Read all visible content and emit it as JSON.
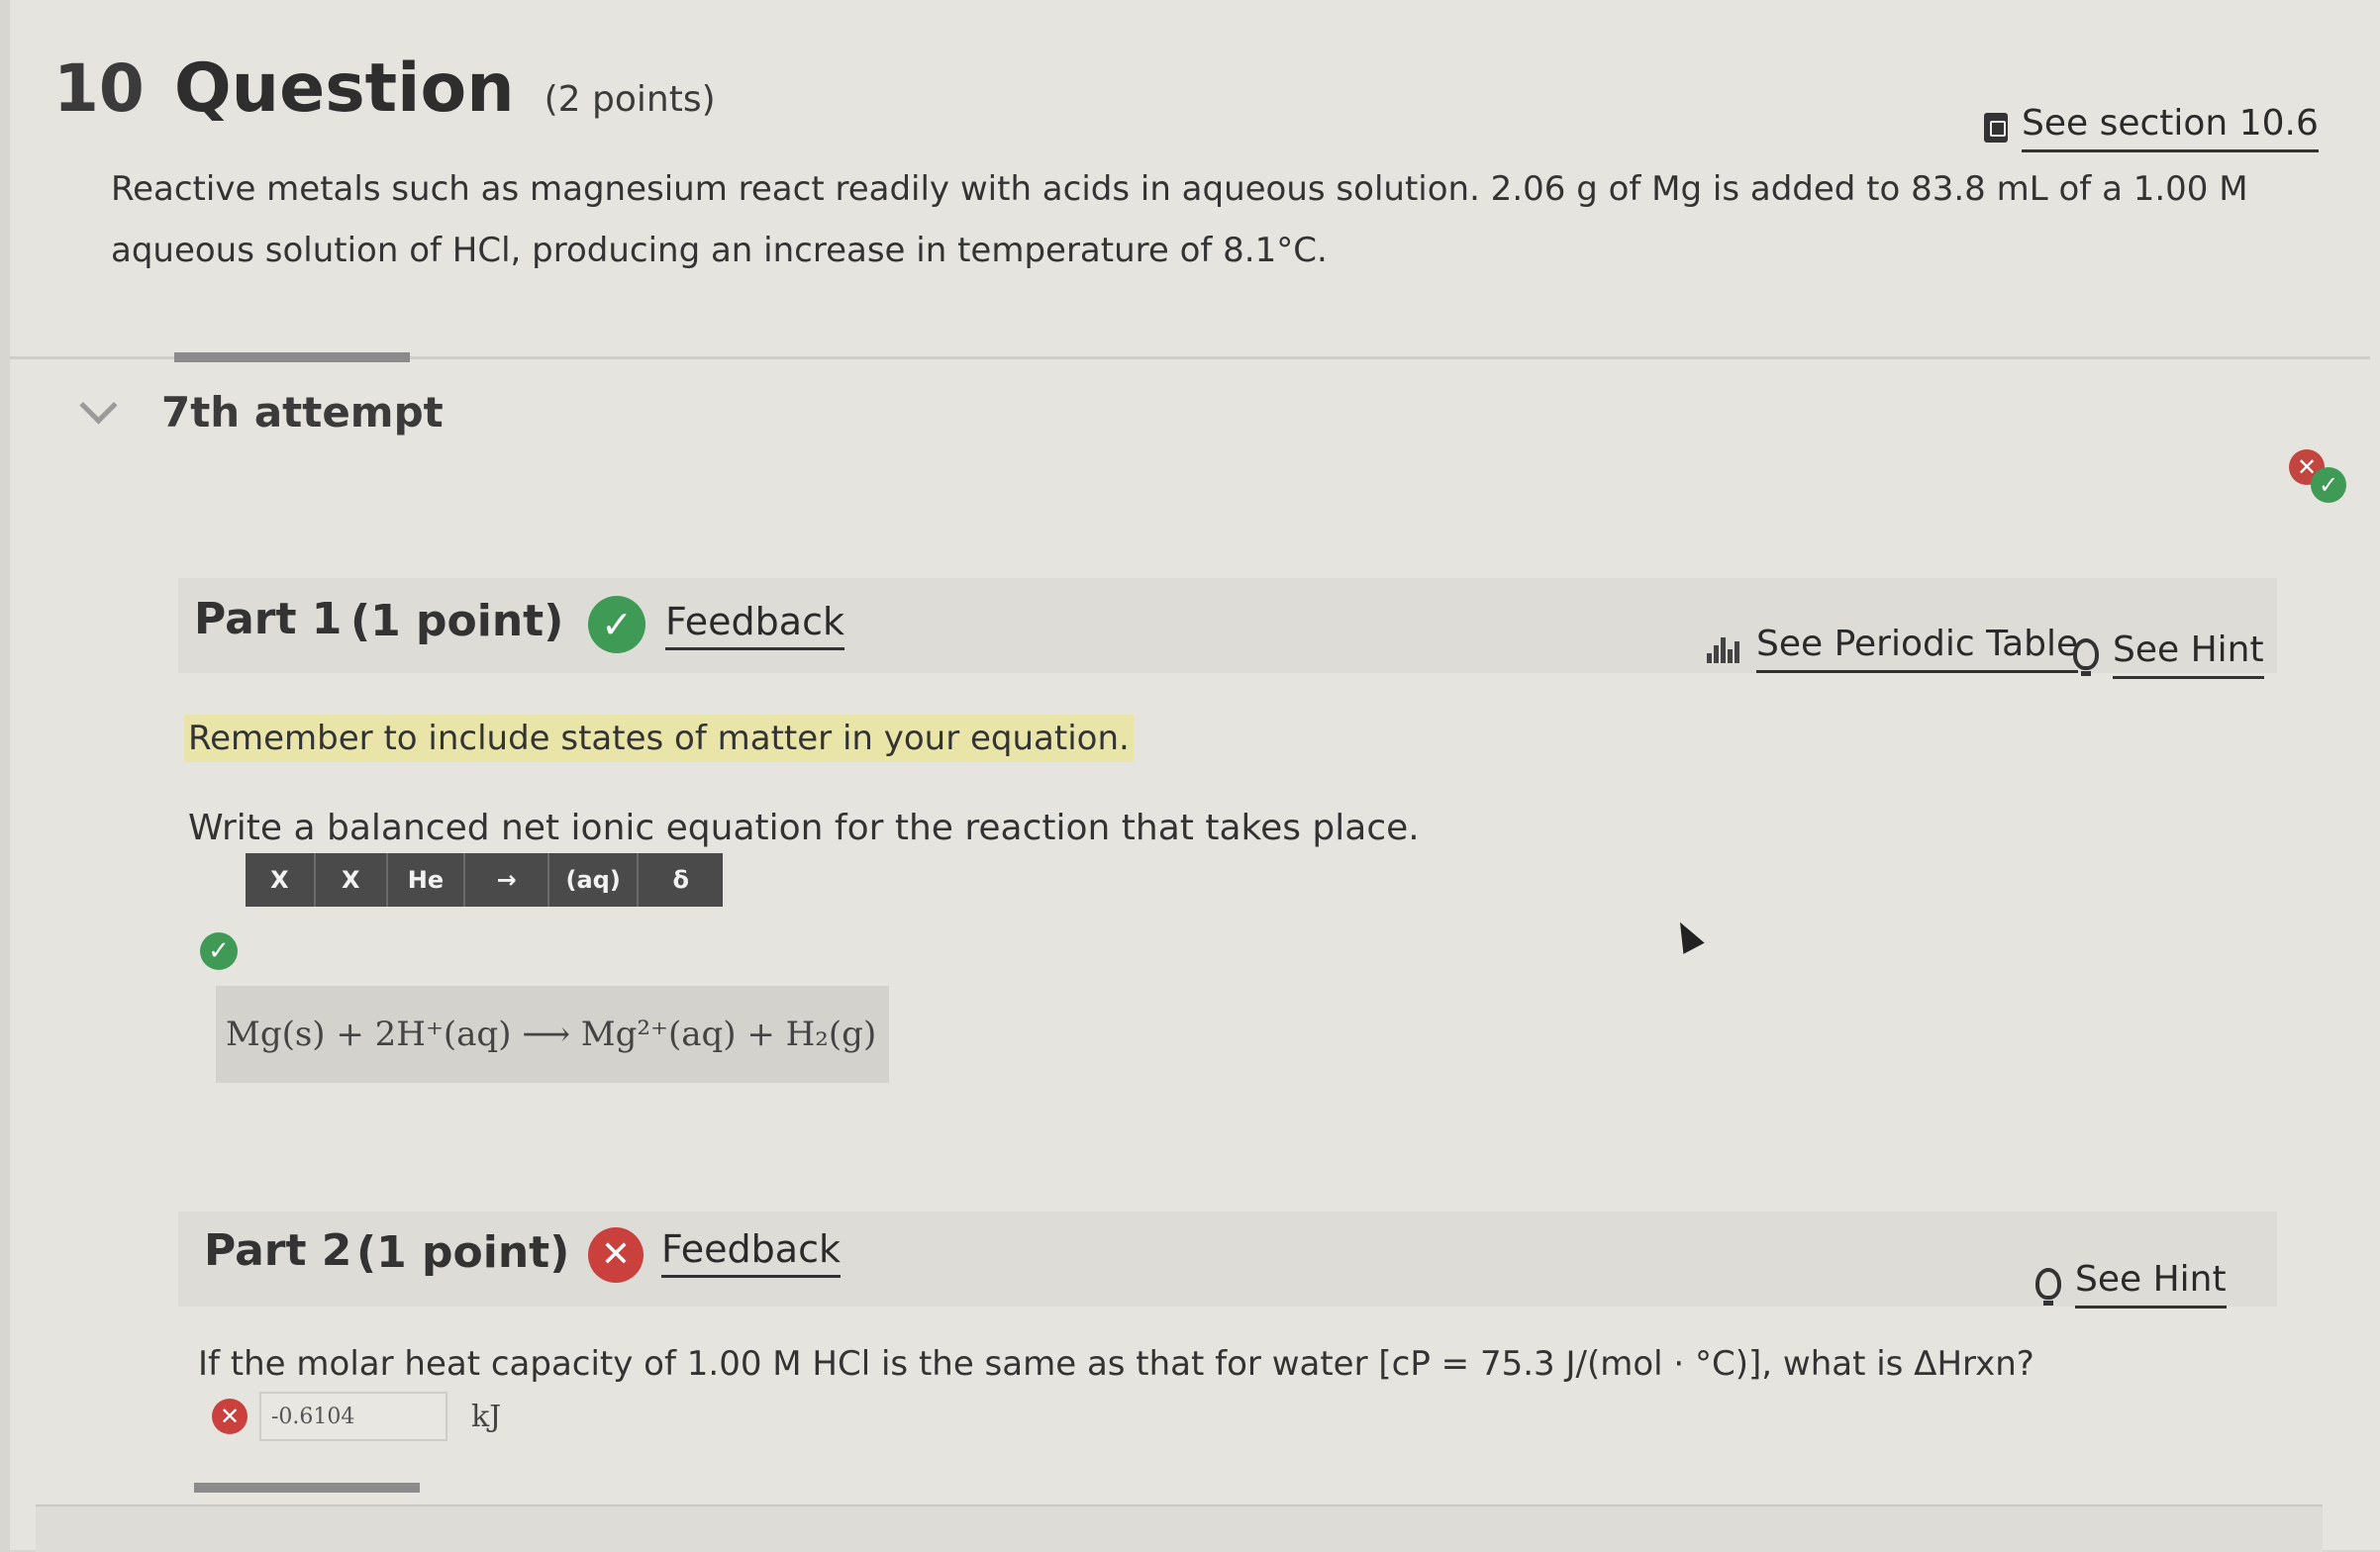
{
  "question": {
    "number": "10",
    "title": "Question",
    "points": "(2 points)",
    "section_link": "See section 10.6",
    "text": "Reactive metals such as magnesium react readily with acids in aqueous solution. 2.06  g of Mg is added to 83.8  mL of a 1.00 M aqueous solution of HCl, producing an increase in temperature of 8.1°C."
  },
  "attempt": {
    "label": "7th attempt"
  },
  "part1": {
    "title": "Part 1",
    "points": "(1 point)",
    "feedback": "Feedback",
    "periodic_table": "See Periodic Table",
    "hint": "See Hint",
    "reminder": "Remember to include states of matter in your equation.",
    "prompt": "Write a balanced net ionic equation for the reaction that takes place.",
    "toolbar": [
      "X",
      "X",
      "He",
      "→",
      "(aq)",
      "δ"
    ],
    "equation": "Mg(s) + 2H⁺(aq) ⟶ Mg²⁺(aq) + H₂(g)"
  },
  "part2": {
    "title": "Part 2",
    "points": "(1 point)",
    "feedback": "Feedback",
    "hint": "See Hint",
    "question": "If the molar heat capacity of 1.00 M HCl is the same as that for water [cP = 75.3 J/(mol · °C)], what is ΔHrxn?",
    "answer_value": "-0.6104",
    "unit": "kJ"
  },
  "colors": {
    "correct": "#3e9a54",
    "incorrect": "#c9403d",
    "highlight": "#e9e5a8"
  },
  "icons": [
    "book-icon",
    "chevron-down-icon",
    "check-icon",
    "x-icon",
    "periodic-table-icon",
    "lightbulb-icon",
    "cursor-icon"
  ]
}
